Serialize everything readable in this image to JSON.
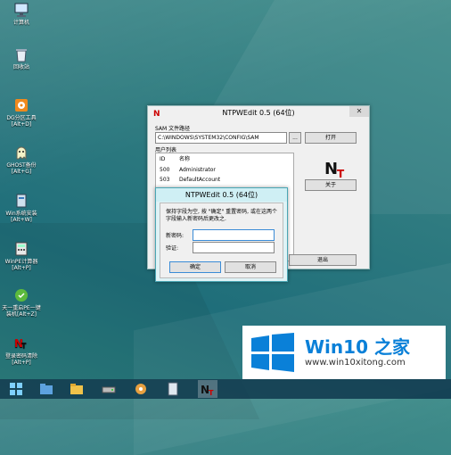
{
  "desktop": {
    "icons": [
      {
        "label": "计算机",
        "name": "computer-icon"
      },
      {
        "label": "回收站",
        "name": "recycle-bin-icon"
      },
      {
        "label": "DG分区工具",
        "label2": "[Alt+D]",
        "name": "diskgenius-icon"
      },
      {
        "label": "GHOST备份",
        "label2": "[Alt+G]",
        "name": "ghost-icon"
      },
      {
        "label": "Win系统安装",
        "label2": "[Alt+W]",
        "name": "win-install-icon"
      },
      {
        "label": "WinPE计算器",
        "label2": "[Alt+P]",
        "name": "calculator-icon"
      },
      {
        "label": "天一重启PE一键",
        "label2": "装机[Alt+Z]",
        "name": "onekey-install-icon"
      },
      {
        "label": "登录密码清除",
        "label2": "[Alt+P]",
        "name": "password-clear-icon"
      }
    ]
  },
  "main_window": {
    "title": "NTPWEdit 0.5 (64位)",
    "sam_label": "SAM 文件路径",
    "sam_path": "C:\\WINDOWS\\SYSTEM32\\CONFIG\\SAM",
    "browse_label": "...",
    "open_label": "打开",
    "users_label": "用户列表",
    "col_id": "ID",
    "col_name": "名称",
    "users": [
      {
        "id": "500",
        "name": "Administrator"
      },
      {
        "id": "503",
        "name": "DefaultAccount"
      }
    ],
    "about_label": "关于",
    "exit_label": "退出"
  },
  "dialog": {
    "title": "NTPWEdit 0.5 (64位)",
    "message": "保持字段为空, 按 \"确定\" 重置密码, 或在这两个字段输入新密码后更改之.",
    "new_password_label": "新密码:",
    "confirm_label": "验证:",
    "ok_label": "确定",
    "cancel_label": "取消"
  },
  "watermark": {
    "title": "Win10 之家",
    "url": "www.win10xitong.com"
  },
  "colors": {
    "accent": "#0a80d8",
    "desktop": "#2f7b80"
  }
}
